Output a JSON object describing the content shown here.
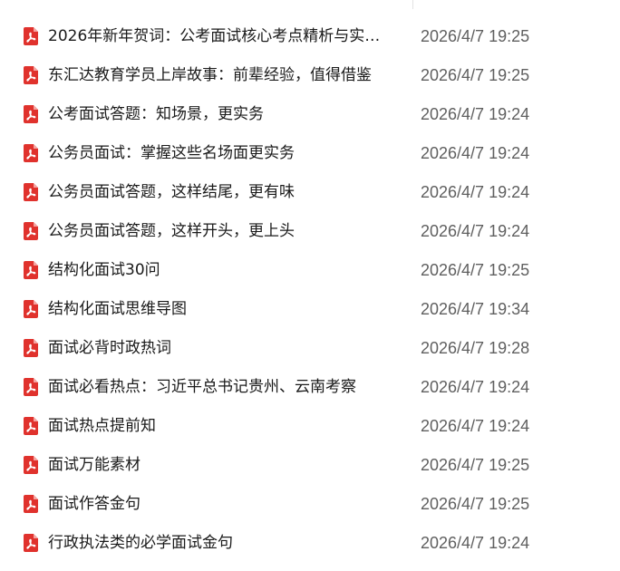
{
  "file_icon": "pdf-file-icon",
  "icon_color": "#e0322d",
  "files": [
    {
      "name": "2026年新年贺词：公考面试核心考点精析与实…",
      "date": "2026/4/7 19:25"
    },
    {
      "name": "东汇达教育学员上岸故事：前辈经验，值得借鉴",
      "date": "2026/4/7 19:25"
    },
    {
      "name": "公考面试答题：知场景，更实务",
      "date": "2026/4/7 19:24"
    },
    {
      "name": "公务员面试：掌握这些名场面更实务",
      "date": "2026/4/7 19:24"
    },
    {
      "name": "公务员面试答题，这样结尾，更有味",
      "date": "2026/4/7 19:24"
    },
    {
      "name": "公务员面试答题，这样开头，更上头",
      "date": "2026/4/7 19:24"
    },
    {
      "name": "结构化面试30问",
      "date": "2026/4/7 19:25"
    },
    {
      "name": "结构化面试思维导图",
      "date": "2026/4/7 19:34"
    },
    {
      "name": "面试必背时政热词",
      "date": "2026/4/7 19:28"
    },
    {
      "name": "面试必看热点：习近平总书记贵州、云南考察",
      "date": "2026/4/7 19:24"
    },
    {
      "name": "面试热点提前知",
      "date": "2026/4/7 19:24"
    },
    {
      "name": "面试万能素材",
      "date": "2026/4/7 19:25"
    },
    {
      "name": "面试作答金句",
      "date": "2026/4/7 19:25"
    },
    {
      "name": "行政执法类的必学面试金句",
      "date": "2026/4/7 19:24"
    }
  ]
}
